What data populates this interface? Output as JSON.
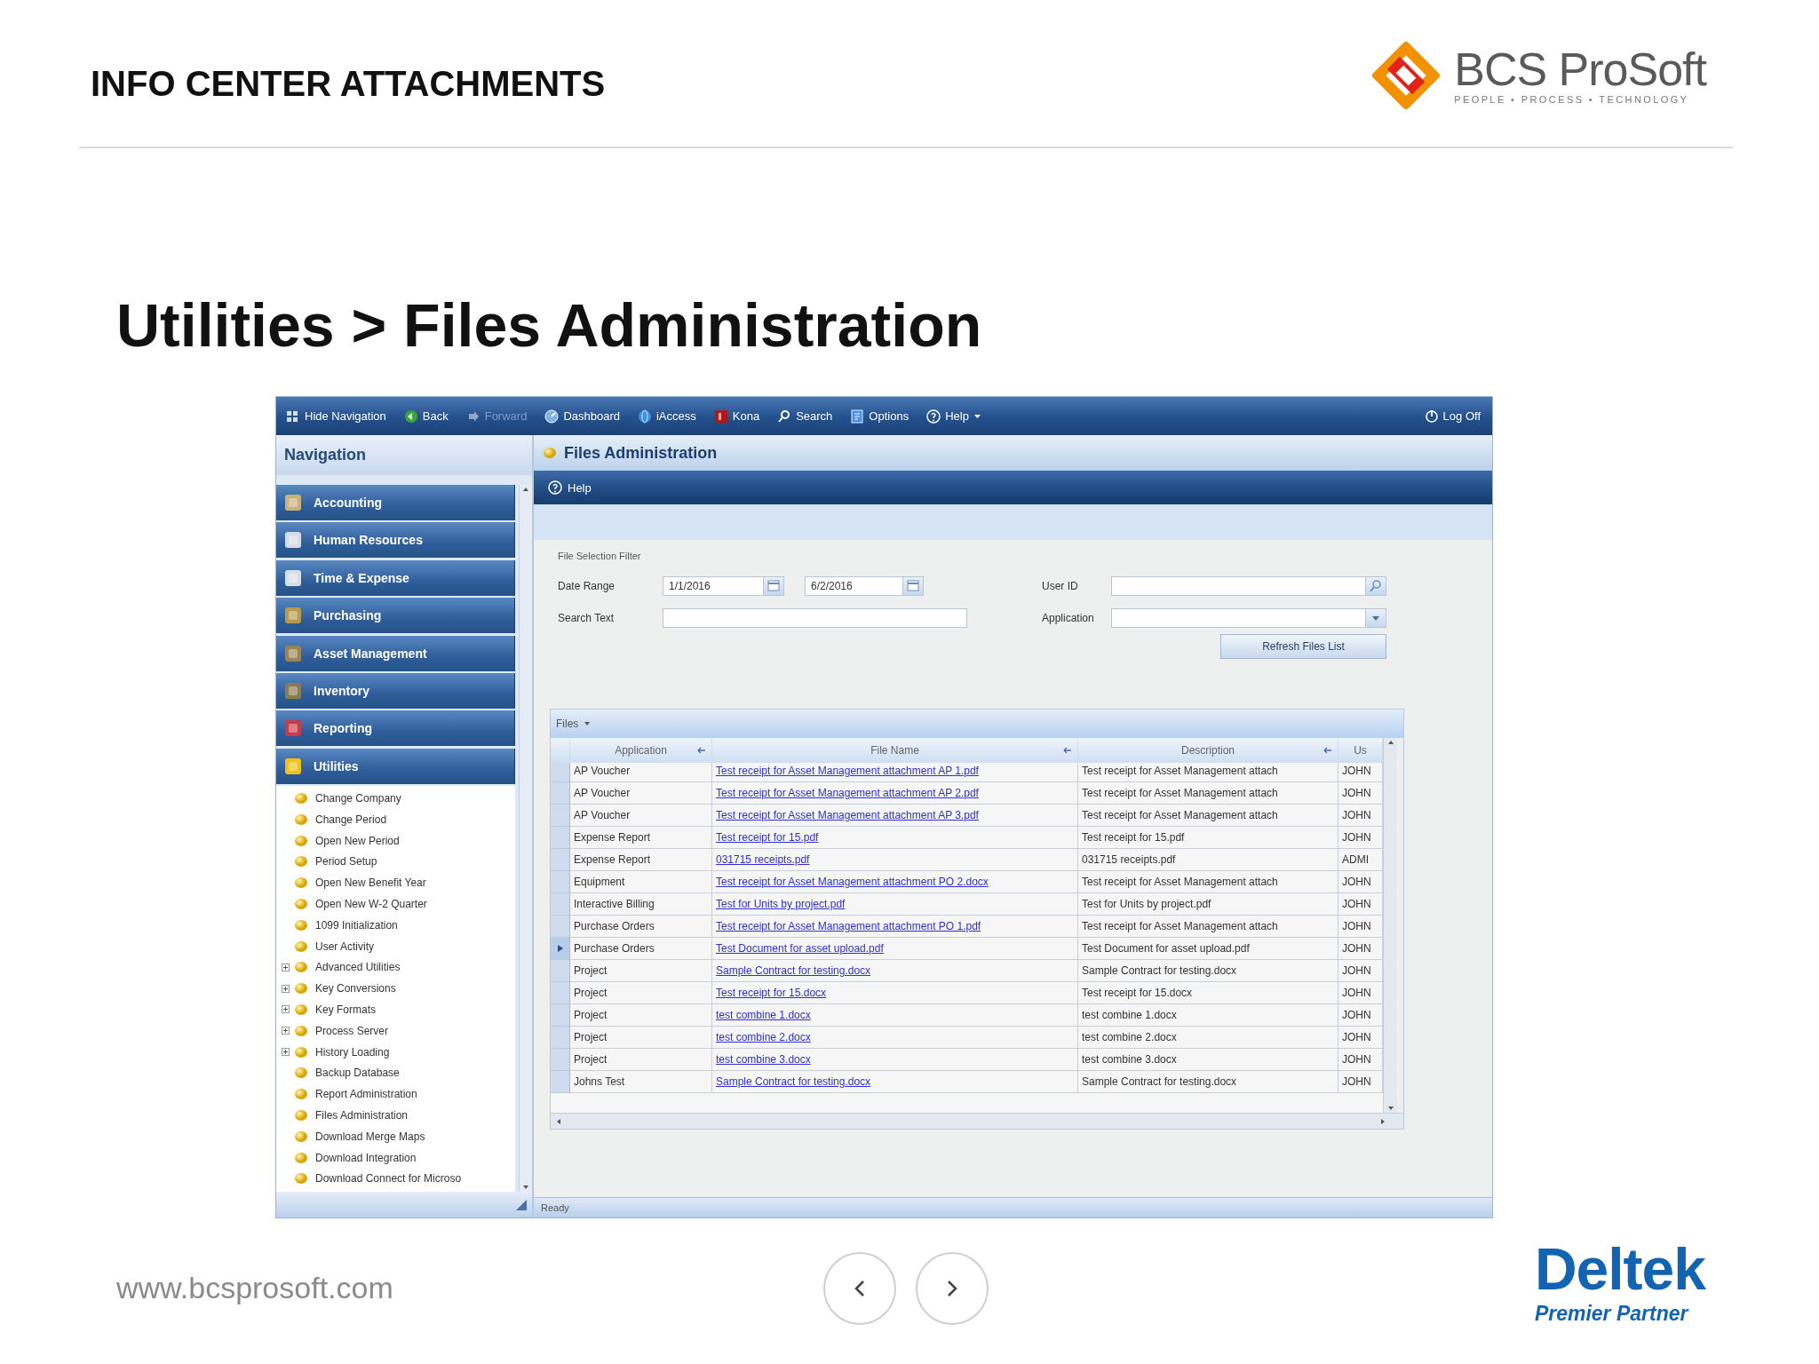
{
  "slide": {
    "title": "INFO CENTER ATTACHMENTS",
    "heading": "Utilities > Files Administration",
    "logo": {
      "name": "BCS ProSoft",
      "tagline": "PEOPLE • PROCESS • TECHNOLOGY"
    }
  },
  "toolbar": {
    "items": [
      {
        "label": "Hide Navigation",
        "kind": "button",
        "disabled": false
      },
      {
        "label": "Back",
        "kind": "button",
        "disabled": false
      },
      {
        "label": "Forward",
        "kind": "button",
        "disabled": true
      },
      {
        "label": "Dashboard",
        "kind": "button",
        "disabled": false
      },
      {
        "label": "iAccess",
        "kind": "button",
        "disabled": false
      },
      {
        "label": "Kona",
        "kind": "button",
        "disabled": false
      },
      {
        "label": "Search",
        "kind": "button",
        "disabled": false
      },
      {
        "label": "Options",
        "kind": "button",
        "disabled": false
      },
      {
        "label": "Help",
        "kind": "menu",
        "disabled": false
      }
    ],
    "logoff": "Log Off"
  },
  "navigation": {
    "title": "Navigation",
    "modules": [
      {
        "label": "Accounting"
      },
      {
        "label": "Human Resources"
      },
      {
        "label": "Time & Expense"
      },
      {
        "label": "Purchasing"
      },
      {
        "label": "Asset Management"
      },
      {
        "label": "Inventory"
      },
      {
        "label": "Reporting"
      },
      {
        "label": "Utilities",
        "children": [
          {
            "label": "Change Company",
            "kind": "leaf"
          },
          {
            "label": "Change Period",
            "kind": "leaf"
          },
          {
            "label": "Open New Period",
            "kind": "leaf"
          },
          {
            "label": "Period Setup",
            "kind": "leaf"
          },
          {
            "label": "Open New Benefit Year",
            "kind": "leaf"
          },
          {
            "label": "Open New W-2 Quarter",
            "kind": "leaf"
          },
          {
            "label": "1099 Initialization",
            "kind": "leaf"
          },
          {
            "label": "User Activity",
            "kind": "leaf"
          },
          {
            "label": "Advanced Utilities",
            "kind": "group"
          },
          {
            "label": "Key Conversions",
            "kind": "group"
          },
          {
            "label": "Key Formats",
            "kind": "group"
          },
          {
            "label": "Process Server",
            "kind": "group"
          },
          {
            "label": "History Loading",
            "kind": "group"
          },
          {
            "label": "Backup Database",
            "kind": "leaf"
          },
          {
            "label": "Report Administration",
            "kind": "leaf"
          },
          {
            "label": "Files Administration",
            "kind": "leaf"
          },
          {
            "label": "Download Merge Maps",
            "kind": "leaf"
          },
          {
            "label": "Download Integration",
            "kind": "leaf"
          },
          {
            "label": "Download Connect for Microso",
            "kind": "leaf"
          }
        ]
      }
    ]
  },
  "page": {
    "title": "Files Administration",
    "help": "Help",
    "filter": {
      "title": "File Selection Filter",
      "date_range_label": "Date Range",
      "date_from": "1/1/2016",
      "date_to": "6/2/2016",
      "user_id_label": "User ID",
      "search_text_label": "Search Text",
      "application_label": "Application",
      "refresh_button": "Refresh Files List"
    },
    "files": {
      "title": "Files",
      "columns": [
        "Application",
        "File Name",
        "Description",
        "Us"
      ],
      "rows": [
        {
          "application": "AP Voucher",
          "file_name": "Test receipt for Asset Management attachment AP 1.pdf",
          "description": "Test receipt for Asset Management attach",
          "user": "JOHN",
          "selected": false
        },
        {
          "application": "AP Voucher",
          "file_name": "Test receipt for Asset Management attachment AP 2.pdf",
          "description": "Test receipt for Asset Management attach",
          "user": "JOHN",
          "selected": false
        },
        {
          "application": "AP Voucher",
          "file_name": "Test receipt for Asset Management attachment AP 3.pdf",
          "description": "Test receipt for Asset Management attach",
          "user": "JOHN",
          "selected": false
        },
        {
          "application": "Expense Report",
          "file_name": "Test receipt for 15.pdf",
          "description": "Test receipt for 15.pdf",
          "user": "JOHN",
          "selected": false
        },
        {
          "application": "Expense Report",
          "file_name": "031715 receipts.pdf",
          "description": "031715 receipts.pdf",
          "user": "ADMI",
          "selected": false
        },
        {
          "application": "Equipment",
          "file_name": "Test receipt for Asset Management attachment PO 2.docx",
          "description": "Test receipt for Asset Management attach",
          "user": "JOHN",
          "selected": false
        },
        {
          "application": "Interactive Billing",
          "file_name": "Test for Units by project.pdf",
          "description": "Test for Units by project.pdf",
          "user": "JOHN",
          "selected": false
        },
        {
          "application": "Purchase Orders",
          "file_name": "Test receipt for Asset Management attachment PO 1.pdf",
          "description": "Test receipt for Asset Management attach",
          "user": "JOHN",
          "selected": false
        },
        {
          "application": "Purchase Orders",
          "file_name": "Test Document for asset upload.pdf",
          "description": "Test Document for asset upload.pdf",
          "user": "JOHN",
          "selected": true
        },
        {
          "application": "Project",
          "file_name": "Sample Contract for testing.docx",
          "description": "Sample Contract for testing.docx",
          "user": "JOHN",
          "selected": false
        },
        {
          "application": "Project",
          "file_name": "Test receipt for 15.docx",
          "description": "Test receipt for 15.docx",
          "user": "JOHN",
          "selected": false
        },
        {
          "application": "Project",
          "file_name": "test combine 1.docx",
          "description": "test combine 1.docx",
          "user": "JOHN",
          "selected": false
        },
        {
          "application": "Project",
          "file_name": "test combine 2.docx",
          "description": "test combine 2.docx",
          "user": "JOHN",
          "selected": false
        },
        {
          "application": "Project",
          "file_name": "test combine 3.docx",
          "description": "test combine 3.docx",
          "user": "JOHN",
          "selected": false
        },
        {
          "application": "Johns Test",
          "file_name": "Sample Contract for testing.docx",
          "description": "Sample Contract for testing.docx",
          "user": "JOHN",
          "selected": false
        }
      ]
    },
    "status": "Ready"
  },
  "footer": {
    "url": "www.bcsprosoft.com",
    "partner": {
      "name": "Deltek",
      "tier": "Premier Partner"
    }
  }
}
